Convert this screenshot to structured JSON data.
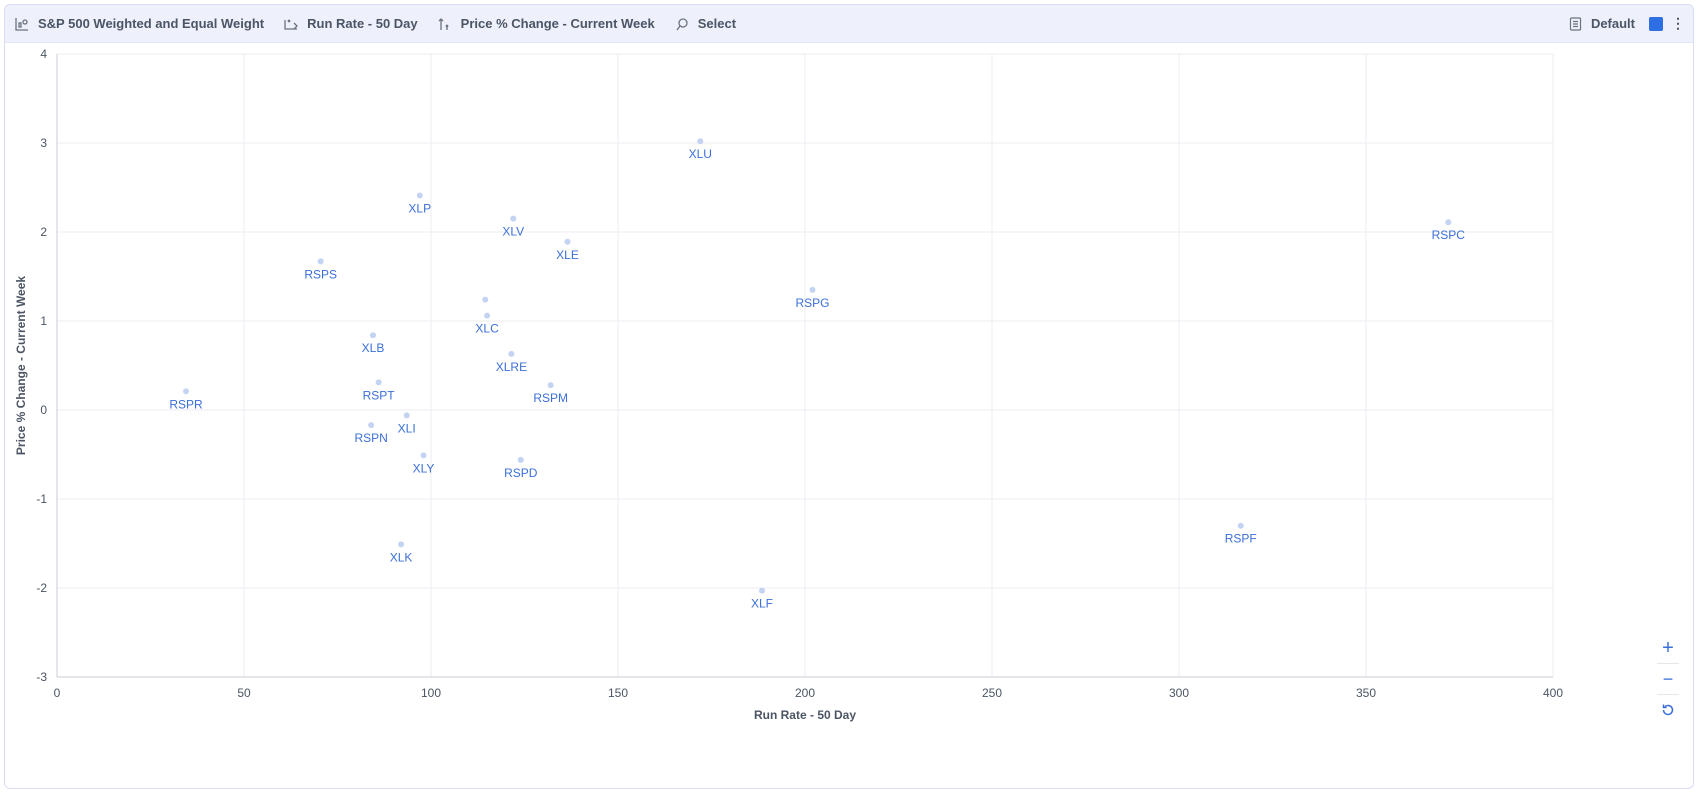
{
  "toolbar": {
    "chart_title": "S&P 500 Weighted and Equal Weight",
    "x_metric": "Run Rate - 50 Day",
    "y_metric": "Price % Change - Current Week",
    "select_label": "Select",
    "preset_label": "Default",
    "icons": [
      "chart-icon",
      "x-axis-icon",
      "y-axis-icon",
      "select-icon",
      "document-icon",
      "kebab-icon"
    ]
  },
  "colors": {
    "accent": "#2f6fe4",
    "point": "#c3d3f1",
    "label": "#3b6fd8",
    "toolbar_bg": "#eef0fb"
  },
  "zoom": {
    "zoom_in": "+",
    "zoom_out": "−",
    "reset": "reset-icon"
  },
  "chart_data": {
    "type": "scatter",
    "xlabel": "Run Rate - 50 Day",
    "ylabel": "Price % Change - Current Week",
    "xlim": [
      0,
      400
    ],
    "ylim": [
      -3,
      4
    ],
    "xticks": [
      0,
      50,
      100,
      150,
      200,
      250,
      300,
      350,
      400
    ],
    "yticks": [
      -3,
      -2,
      -1,
      0,
      1,
      2,
      3,
      4
    ],
    "grid": true,
    "points": [
      {
        "label": "XLU",
        "x": 172,
        "y": 3.02
      },
      {
        "label": "XLP",
        "x": 97,
        "y": 2.41
      },
      {
        "label": "XLV",
        "x": 122,
        "y": 2.15
      },
      {
        "label": "RSPC",
        "x": 372,
        "y": 2.11
      },
      {
        "label": "XLE",
        "x": 136.5,
        "y": 1.89
      },
      {
        "label": "RSPS",
        "x": 70.5,
        "y": 1.67
      },
      {
        "label": "RSPG",
        "x": 202,
        "y": 1.35
      },
      {
        "label": "",
        "x": 114.5,
        "y": 1.24
      },
      {
        "label": "XLC",
        "x": 115,
        "y": 1.06
      },
      {
        "label": "XLB",
        "x": 84.5,
        "y": 0.84
      },
      {
        "label": "XLRE",
        "x": 121.5,
        "y": 0.63
      },
      {
        "label": "RSPT",
        "x": 86,
        "y": 0.31
      },
      {
        "label": "RSPM",
        "x": 132,
        "y": 0.28
      },
      {
        "label": "RSPR",
        "x": 34.5,
        "y": 0.21
      },
      {
        "label": "XLI",
        "x": 93.5,
        "y": -0.06
      },
      {
        "label": "RSPN",
        "x": 84,
        "y": -0.17
      },
      {
        "label": "XLY",
        "x": 98,
        "y": -0.51
      },
      {
        "label": "RSPD",
        "x": 124,
        "y": -0.56
      },
      {
        "label": "RSPF",
        "x": 316.5,
        "y": -1.3
      },
      {
        "label": "XLK",
        "x": 92,
        "y": -1.51
      },
      {
        "label": "XLF",
        "x": 188.5,
        "y": -2.03
      }
    ]
  }
}
